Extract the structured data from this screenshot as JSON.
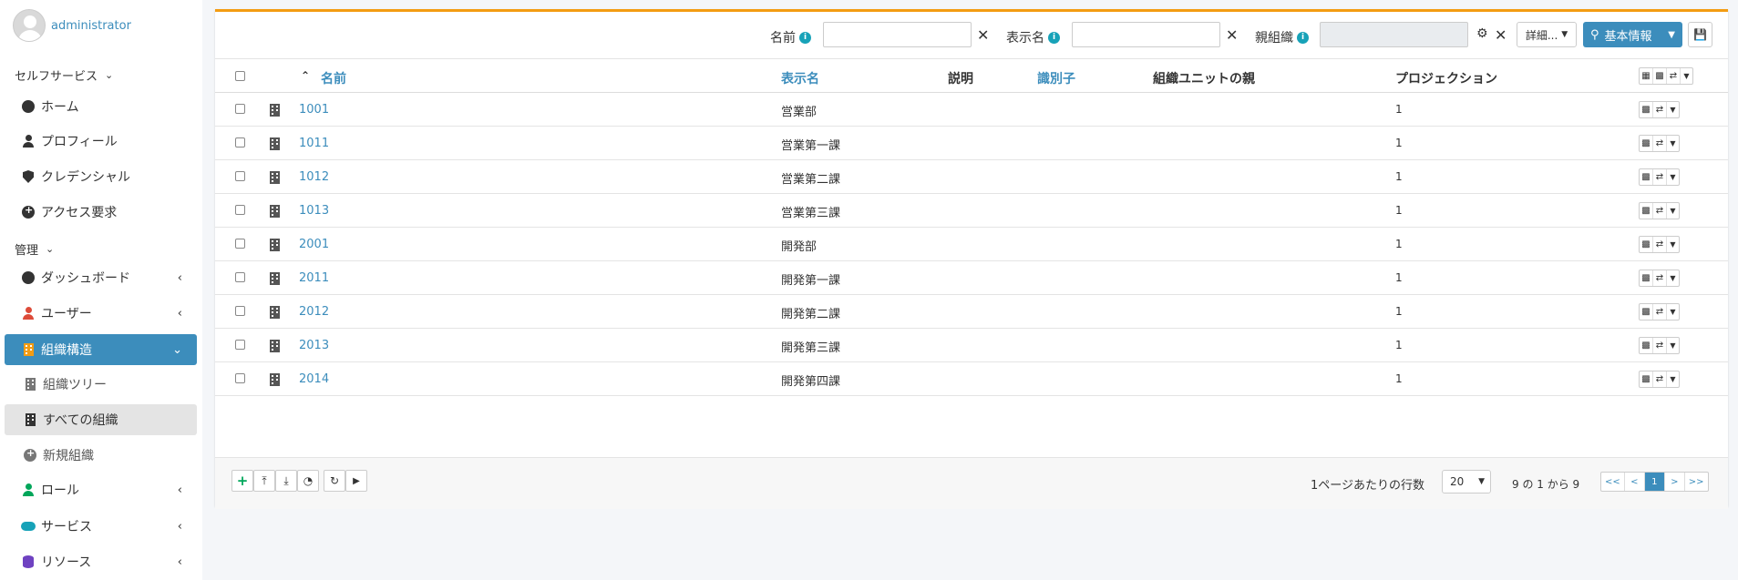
{
  "user": {
    "name": "administrator"
  },
  "sidebar": {
    "section_self": "セルフサービス",
    "self_items": [
      {
        "label": "ホーム",
        "icon": "dashboard-icon"
      },
      {
        "label": "プロフィール",
        "icon": "person-icon"
      },
      {
        "label": "クレデンシャル",
        "icon": "shield-icon"
      },
      {
        "label": "アクセス要求",
        "icon": "plus-circle-icon"
      }
    ],
    "section_admin": "管理",
    "admin_items": [
      {
        "label": "ダッシュボード",
        "icon": "dashboard-icon"
      },
      {
        "label": "ユーザー",
        "icon": "person-icon"
      },
      {
        "label": "組織構造",
        "icon": "building-icon"
      },
      {
        "label": "組織ツリー",
        "icon": "building-icon"
      },
      {
        "label": "すべての組織",
        "icon": "building-icon"
      },
      {
        "label": "新規組織",
        "icon": "plus-circle-icon"
      },
      {
        "label": "ロール",
        "icon": "role-icon"
      },
      {
        "label": "サービス",
        "icon": "cloud-icon"
      },
      {
        "label": "リソース",
        "icon": "database-icon"
      }
    ]
  },
  "toolbar": {
    "filter_name_label": "名前",
    "filter_name_value": "",
    "filter_display_label": "表示名",
    "filter_display_value": "",
    "filter_parent_label": "親組織",
    "filter_parent_value": "",
    "detail_label": "詳細...",
    "basic_label": "基本情報"
  },
  "table": {
    "columns": [
      "名前",
      "表示名",
      "説明",
      "識別子",
      "組織ユニットの親",
      "プロジェクション"
    ],
    "rows": [
      {
        "name": "1001",
        "display": "営業部",
        "projection": "1"
      },
      {
        "name": "1011",
        "display": "営業第一課",
        "projection": "1"
      },
      {
        "name": "1012",
        "display": "営業第二課",
        "projection": "1"
      },
      {
        "name": "1013",
        "display": "営業第三課",
        "projection": "1"
      },
      {
        "name": "2001",
        "display": "開発部",
        "projection": "1"
      },
      {
        "name": "2011",
        "display": "開発第一課",
        "projection": "1"
      },
      {
        "name": "2012",
        "display": "開発第二課",
        "projection": "1"
      },
      {
        "name": "2013",
        "display": "開発第三課",
        "projection": "1"
      },
      {
        "name": "2014",
        "display": "開発第四課",
        "projection": "1"
      }
    ]
  },
  "footer": {
    "rows_per_page_label": "1ページあたりの行数",
    "rows_per_page": "20",
    "range": "9 の 1 から 9",
    "pager": [
      "<<",
      "<",
      "1",
      ">",
      ">>"
    ]
  },
  "colors": {
    "accent": "#3c8dbc",
    "card_border": "#f39c12"
  }
}
